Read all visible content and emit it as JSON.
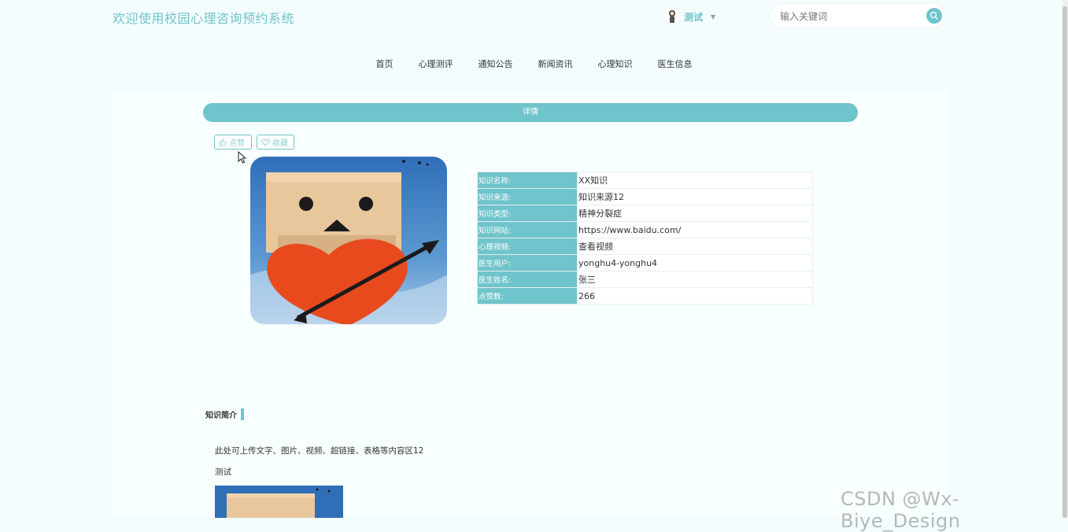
{
  "header": {
    "site_title": "欢迎使用校园心理咨询预约系统",
    "user_name": "测试",
    "search_placeholder": "输入关键词"
  },
  "nav": {
    "items": [
      "首页",
      "心理测评",
      "通知公告",
      "新闻资讯",
      "心理知识",
      "医生信息"
    ]
  },
  "detail": {
    "bar_title": "详情",
    "like_label": "点赞",
    "favorite_label": "收藏",
    "fields": [
      {
        "key": "知识名称:",
        "value": "XX知识"
      },
      {
        "key": "知识来源:",
        "value": "知识来源12"
      },
      {
        "key": "知识类型:",
        "value": "精神分裂症"
      },
      {
        "key": "知识网站:",
        "value": "https://www.baidu.com/"
      },
      {
        "key": "心理视频:",
        "value": "查看视频"
      },
      {
        "key": "医生用户:",
        "value": "yonghu4-yonghu4"
      },
      {
        "key": "医生姓名:",
        "value": "张三"
      },
      {
        "key": "点赞数:",
        "value": "266"
      }
    ]
  },
  "intro": {
    "section_title": "知识简介",
    "line1": "此处可上传文字、图片、视频、超链接、表格等内容区12",
    "line2": "测试"
  },
  "watermark": "CSDN @Wx-Biye_Design",
  "colors": {
    "accent": "#70c4cb",
    "background": "#f4fdfd"
  }
}
